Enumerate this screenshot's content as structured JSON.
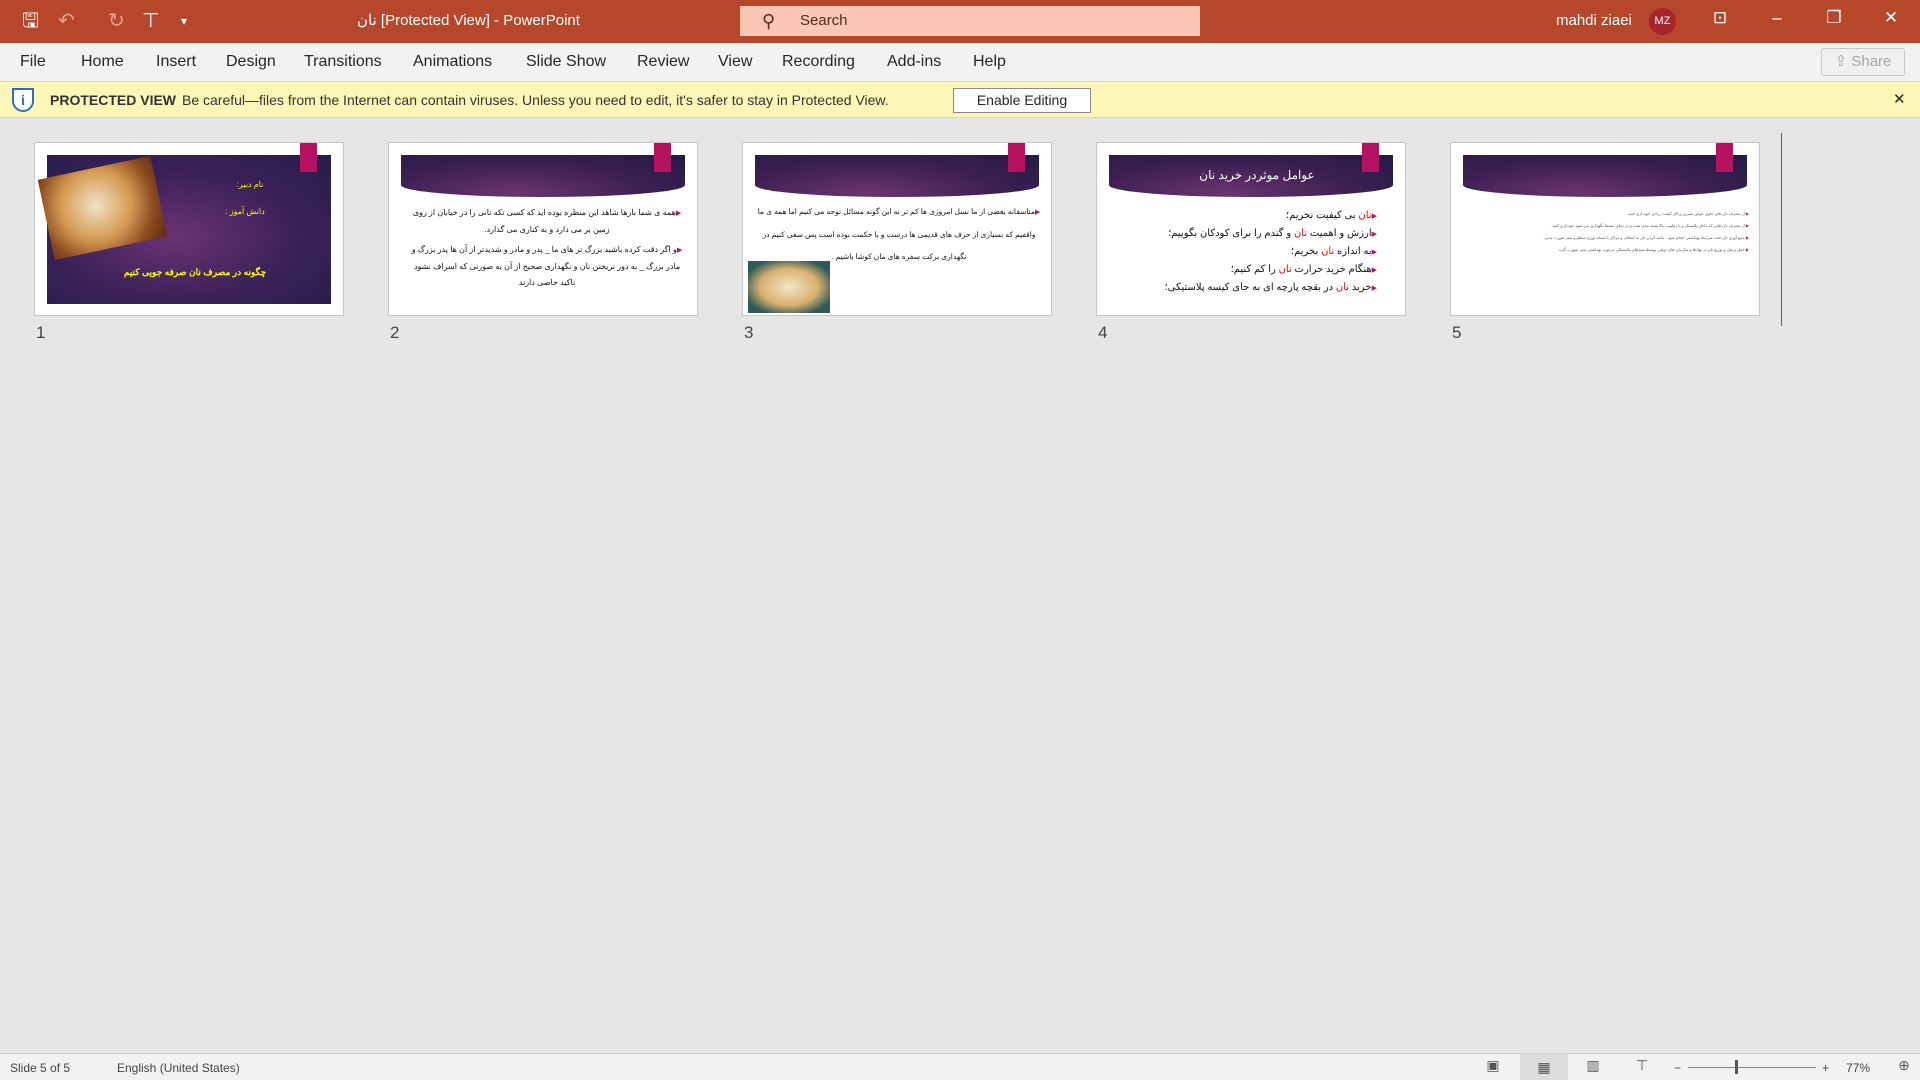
{
  "titlebar": {
    "title": "نان [Protected View]  -  PowerPoint",
    "search_placeholder": "Search",
    "user": "mahdi ziaei",
    "initials": "MZ"
  },
  "ribbon": {
    "tabs": [
      "File",
      "Home",
      "Insert",
      "Design",
      "Transitions",
      "Animations",
      "Slide Show",
      "Review",
      "View",
      "Recording",
      "Add-ins",
      "Help"
    ],
    "share": "Share"
  },
  "protected_view": {
    "label": "PROTECTED VIEW",
    "message": "Be careful—files from the Internet can contain viruses. Unless you need to edit, it's safer to stay in Protected View.",
    "button": "Enable Editing"
  },
  "slides": [
    {
      "number": "1",
      "teacher": "نام دبیر:",
      "student": "دانش آموز :",
      "title": "چگونه در مصرف نان صرفه جویی کنیم"
    },
    {
      "number": "2",
      "bullets": [
        "همه ی شما بارها شاهد این منظره بوده اید که کسی تکه نانی را در خیابان از روی زمین بر می دارد و به کناری می گذارد.",
        "و اگر دقت کرده باشید بزرگ تر های ما _ پدر و مادر و شدیدتر از آن ها پدر بزرگ و مادر بزرگ _ به دور نریختن نان و نگهداری صحیح از آن به صورتی که اسراف نشود تاکید خاصی دارند"
      ]
    },
    {
      "number": "3",
      "bullets": [
        "متاسفانه بعضی از ما نسل امروزی ها کم تر به این گونه مسائل توجه می کنیم اما همه ی ما واقفیم که بسیاری از حرف های قدیمی ها درست و با حکمت بوده است پس سعی کنیم در نگهداری برکت سفره های مان کوشا باشیم ."
      ]
    },
    {
      "number": "4",
      "title": "عوامل موثردر خرید نان",
      "bullets": [
        [
          "",
          "نان",
          " بی کیفیت نخریم؛"
        ],
        [
          "ارزش و اهمیت ",
          "نان",
          " و گندم را برای کودکان بگوییم؛"
        ],
        [
          "به اندازه ",
          "نان",
          " بخریم؛"
        ],
        [
          "هنگام خرید حرارت ",
          "نان",
          " را کم کنیم؛"
        ],
        [
          "خرید ",
          "نان",
          " در بقچه پارچه ای به جای کیسه پلاستیکی؛"
        ]
      ]
    },
    {
      "number": "5",
      "bullets": [
        "از مصرف نان های حاوی جوش شیرین و کار کیفیت زیادی خودداری کنید.",
        "از مصرف نان هایی که داخل پلاستیک و با رطوبت بالا بسته بندی شده و در دمای محیط نگهداری می شود خودداری کنید.",
        "جمع آوری نان تحت شرایط بهداشتی انجام شود ، مانند کردن نان به اصناف و مراکز با شبکه توزی منظم و تمیز صورت پذیرد.",
        "حمل و نقل و توزیع نان در نهادها و سازمان های دولتی توسط سبدهای پلاستیکی مرغوب بهداشتی تمیز صورت گیرد."
      ]
    }
  ],
  "status": {
    "slide": "Slide 5 of 5",
    "language": "English (United States)",
    "zoom": "77%"
  },
  "colors": {
    "titlebar": "#b7472a",
    "accent_pink": "#b5135f",
    "protected_bar": "#fcf7b6"
  }
}
